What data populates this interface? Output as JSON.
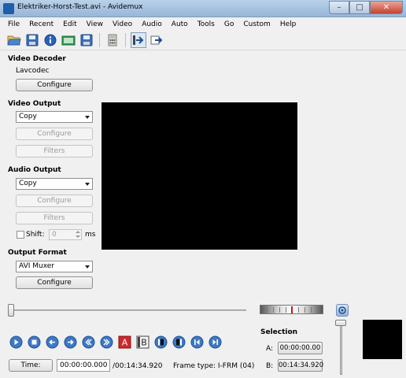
{
  "window": {
    "title": "Elektriker-Horst-Test.avi - Avidemux",
    "minimize_glyph": "–",
    "maximize_glyph": "□",
    "close_glyph": "✕"
  },
  "menu": [
    "File",
    "Recent",
    "Edit",
    "View",
    "Video",
    "Audio",
    "Auto",
    "Tools",
    "Go",
    "Custom",
    "Help"
  ],
  "toolbar": {
    "icons": [
      "open-file-icon",
      "save-icon",
      "info-icon",
      "open-folder-icon",
      "save-as-icon",
      "calculator-icon",
      "play-filtered-icon",
      "output-icon"
    ]
  },
  "video_decoder": {
    "title": "Video Decoder",
    "codec": "Lavcodec",
    "configure_label": "Configure"
  },
  "video_output": {
    "title": "Video Output",
    "selected": "Copy",
    "configure_label": "Configure",
    "filters_label": "Filters"
  },
  "audio_output": {
    "title": "Audio Output",
    "selected": "Copy",
    "configure_label": "Configure",
    "filters_label": "Filters",
    "shift_label": "Shift:",
    "shift_value": "0",
    "shift_unit": "ms"
  },
  "output_format": {
    "title": "Output Format",
    "selected": "AVI Muxer",
    "configure_label": "Configure"
  },
  "timeline": {
    "time_button_label": "Time:",
    "current_time": "00:00:00.000",
    "total_time": "/00:14:34.920",
    "frame_type": "Frame type:  I-FRM (04)",
    "position": 0
  },
  "selection": {
    "title": "Selection",
    "a_label": "A:",
    "a_value": "00:00:00.00",
    "b_label": "B:",
    "b_value": "00:14:34.920"
  },
  "nav_buttons": [
    "play-icon",
    "stop-icon",
    "previous-frame-icon",
    "next-frame-icon",
    "previous-keyframe-icon",
    "next-keyframe-icon",
    "set-marker-a-icon",
    "set-marker-b-icon",
    "previous-black-frame-icon",
    "next-black-frame-icon",
    "go-to-first-frame-icon",
    "go-to-last-frame-icon"
  ],
  "colors": {
    "accent": "#2a63b5",
    "marker_red": "#c0181b"
  }
}
